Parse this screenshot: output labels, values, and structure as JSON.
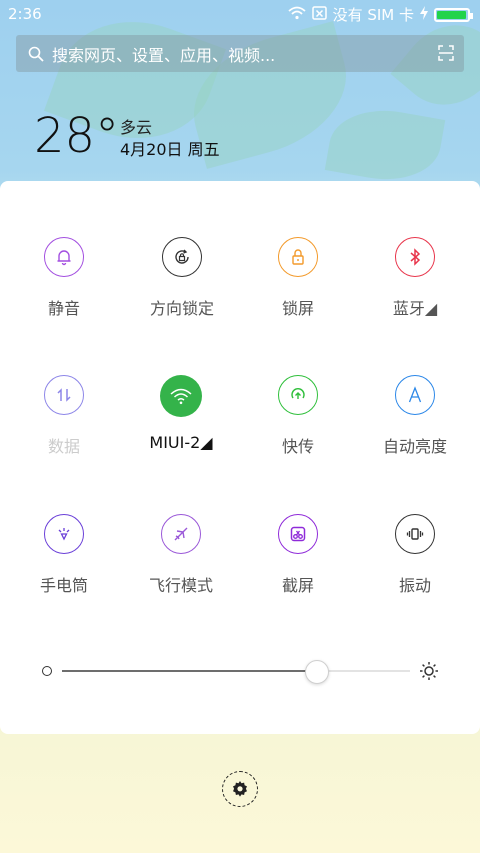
{
  "status_bar": {
    "time": "2:36",
    "carrier": "没有 SIM 卡",
    "icons": [
      "wifi-icon",
      "no-sim-icon",
      "charging-icon",
      "battery-icon"
    ],
    "battery_level": 0.95
  },
  "search": {
    "placeholder": "搜索网页、设置、应用、视频...",
    "icons": [
      "search-icon",
      "scan-icon"
    ]
  },
  "weather": {
    "temperature": "28°",
    "condition": "多云",
    "date": "4月20日 周五"
  },
  "toggles": [
    {
      "label": "静音",
      "icon": "bell-icon",
      "color": "#a34fe0",
      "active": false
    },
    {
      "label": "方向锁定",
      "icon": "rotation-lock-icon",
      "color": "#333333",
      "active": false
    },
    {
      "label": "锁屏",
      "icon": "lock-icon",
      "color": "#f39a2b",
      "active": false
    },
    {
      "label": "蓝牙◢",
      "icon": "bluetooth-icon",
      "color": "#e8354b",
      "active": false
    },
    {
      "label": "数据",
      "icon": "data-icon",
      "color": "#8d86e8",
      "active": false,
      "disabled": true
    },
    {
      "label": "MIUI-2◢",
      "icon": "wifi-icon",
      "color": "#34b34a",
      "active": true
    },
    {
      "label": "快传",
      "icon": "transfer-icon",
      "color": "#2fbf3b",
      "active": false
    },
    {
      "label": "自动亮度",
      "icon": "auto-brightness-icon",
      "color": "#2b87e8",
      "active": false
    },
    {
      "label": "手电筒",
      "icon": "flashlight-icon",
      "color": "#6a3fd8",
      "active": false
    },
    {
      "label": "飞行模式",
      "icon": "airplane-icon",
      "color": "#9a58d8",
      "active": false
    },
    {
      "label": "截屏",
      "icon": "screenshot-icon",
      "color": "#8f2bd9",
      "active": false
    },
    {
      "label": "振动",
      "icon": "vibrate-icon",
      "color": "#333333",
      "active": false
    }
  ],
  "brightness": {
    "level": 0.73
  },
  "footer": {
    "icon": "settings-icon"
  }
}
